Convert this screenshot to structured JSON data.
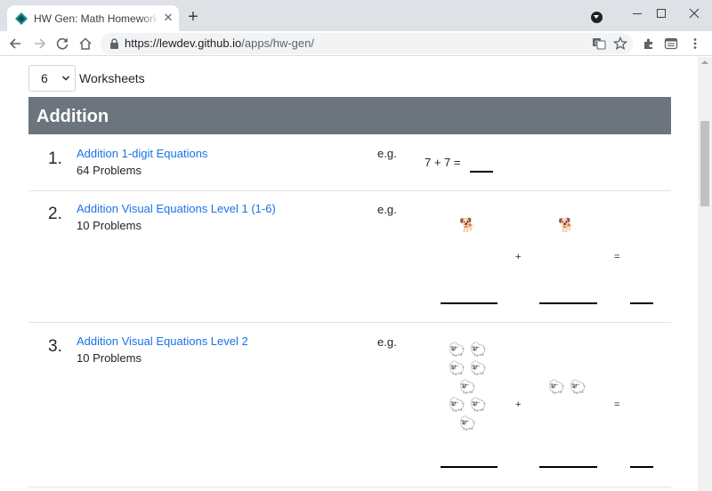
{
  "browser": {
    "tab_title": "HW Gen: Math Homework Gen",
    "url_host": "https://lewdev.github.io",
    "url_path": "/apps/hw-gen/"
  },
  "page": {
    "worksheets_value": "6",
    "worksheets_label": "Worksheets",
    "section_title": "Addition",
    "rows": [
      {
        "num": "1.",
        "title": "Addition 1-digit Equations",
        "count": "64 Problems",
        "eg": "e.g.",
        "example": "7 + 7 ="
      },
      {
        "num": "2.",
        "title": "Addition Visual Equations Level 1 (1-6)",
        "count": "10 Problems",
        "eg": "e.g.",
        "emoji_a": "🐕",
        "emoji_b": "🐕",
        "plus": "+",
        "equals": "="
      },
      {
        "num": "3.",
        "title": "Addition Visual Equations Level 2",
        "count": "10 Problems",
        "eg": "e.g.",
        "emoji": "🐑",
        "plus": "+",
        "equals": "="
      }
    ]
  },
  "colors": {
    "link": "#1a73e8",
    "section_header_bg": "#6c757d",
    "tab_strip": "#dee1e6"
  }
}
